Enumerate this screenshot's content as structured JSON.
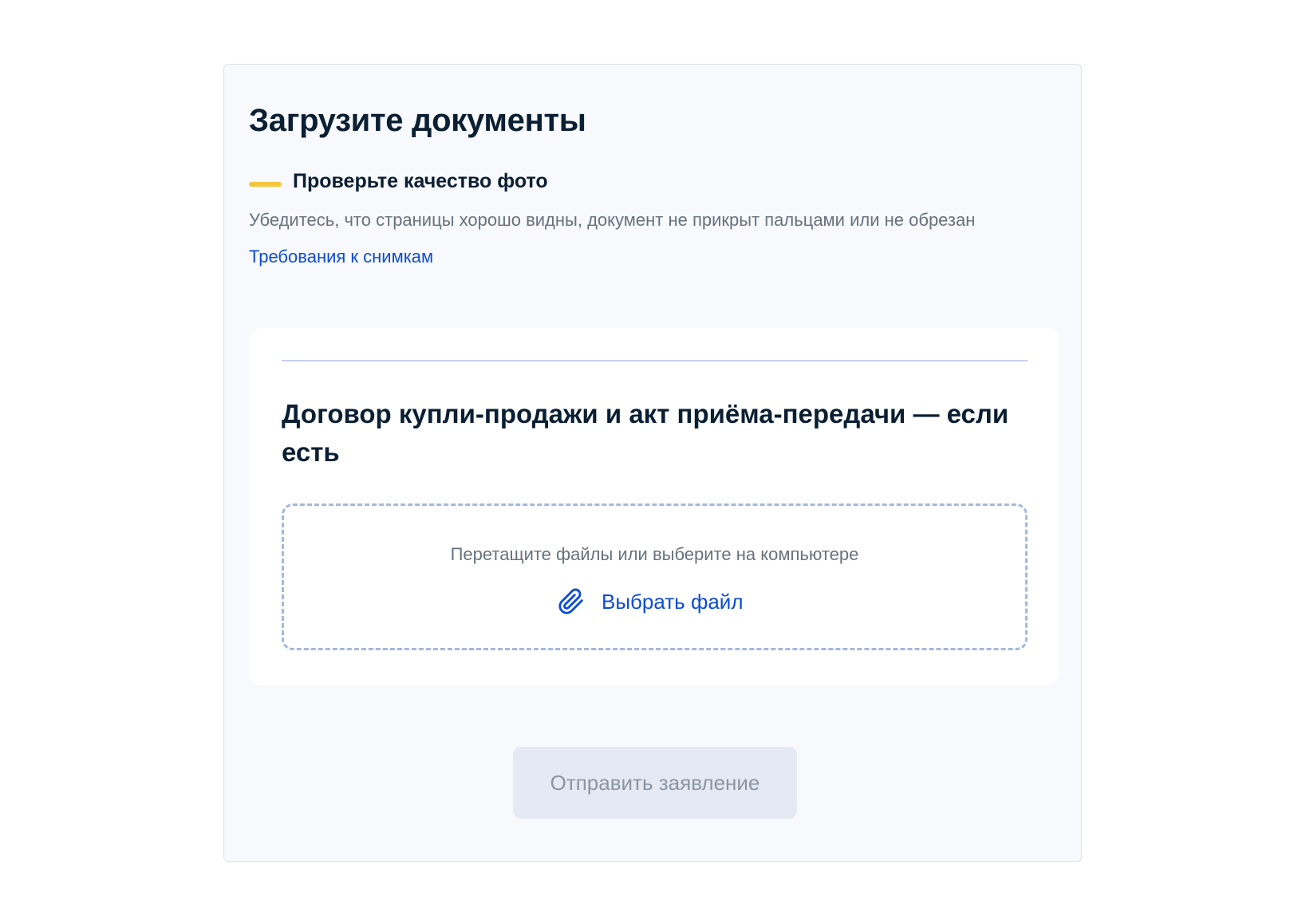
{
  "page": {
    "title": "Загрузите документы"
  },
  "notice": {
    "title": "Проверьте качество фото",
    "text": "Убедитесь, что страницы хорошо видны, документ не прикрыт пальцами или не обрезан",
    "link_label": "Требования к снимкам",
    "accent_color": "#f4c63c"
  },
  "document_section": {
    "title": "Договор купли-продажи и акт приёма-передачи — если есть",
    "dropzone": {
      "hint": "Перетащите файлы или выберите на компьютере",
      "choose_label": "Выбрать файл",
      "icon": "paperclip-icon"
    }
  },
  "actions": {
    "submit_label": "Отправить заявление",
    "submit_disabled": true
  },
  "colors": {
    "link": "#0d4cd3",
    "heading": "#0b1f33",
    "muted_text": "#66727f",
    "panel_bg": "#f8f9fc",
    "disabled_button_bg": "#e4e9f3"
  }
}
